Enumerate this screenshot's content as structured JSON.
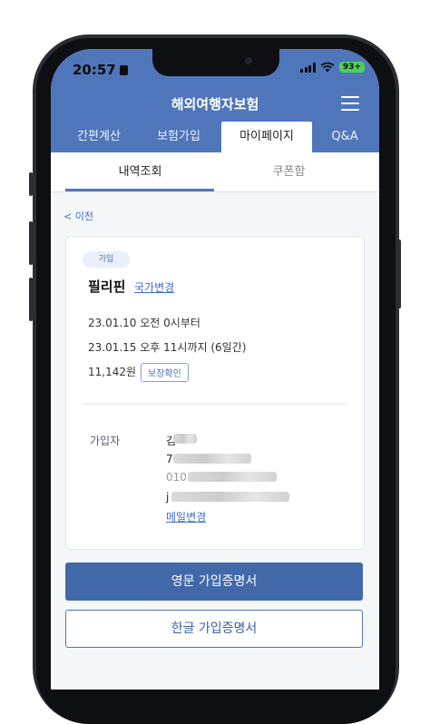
{
  "status_bar": {
    "time": "20:57",
    "battery": "93"
  },
  "header": {
    "title": "해외여행자보험"
  },
  "nav": {
    "tabs": [
      "간편계산",
      "보험가입",
      "마이페이지",
      "Q&A"
    ]
  },
  "subtabs": {
    "history": "내역조회",
    "coupon": "쿠폰함"
  },
  "back": {
    "label": "< 이전"
  },
  "policy": {
    "badge": "가입",
    "country": "필리핀",
    "change_country": "국가변경",
    "start": "23.01.10 오전 0시부터",
    "end": "23.01.15 오후 11시까지 (6일간)",
    "price": "11,142원",
    "coverage_button": "보장확인"
  },
  "subscriber": {
    "label": "가입자",
    "name_initial": "김",
    "dob_initial": "7",
    "phone_prefix": "010",
    "email_initial": "j",
    "change_email": "메일변경"
  },
  "buttons": {
    "english_certificate": "영문 가입증명서",
    "korean_certificate": "한글 가입증명서"
  },
  "colors": {
    "brand": "#4f76ba",
    "primary_button": "#4169aa",
    "link": "#3d6ec8",
    "battery": "#4ad15a"
  }
}
